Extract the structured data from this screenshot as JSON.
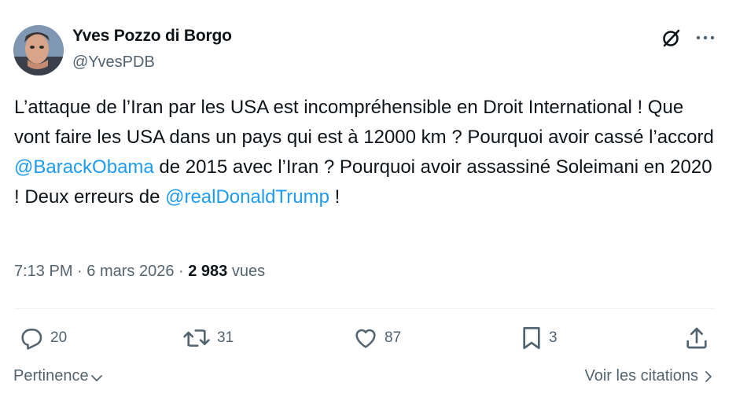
{
  "author": {
    "name": "Yves Pozzo di Borgo",
    "handle": "@YvesPDB"
  },
  "tweet": {
    "text_parts": {
      "p1": "L’attaque de l’Iran par les USA est incompréhensible en Droit International ! Que vont faire les USA dans un pays qui est à 12000 km ? Pourquoi avoir cassé l’accord ",
      "mention1": "@BarackObama",
      "p2": " de 2015 avec l’Iran ? Pourquoi avoir assassiné Soleimani en 2020 ! Deux erreurs de ",
      "mention2": "@realDonaldTrump",
      "p3": " !"
    },
    "time": "7:13 PM",
    "separator": " · ",
    "date": "6 mars 2026",
    "views_count": "2 983",
    "views_label": " vues"
  },
  "actions": {
    "replies": "20",
    "retweets": "31",
    "likes": "87",
    "bookmarks": "3"
  },
  "footer": {
    "sort_label": "Pertinence",
    "quotes_label": "Voir les citations"
  },
  "colors": {
    "accent": "#1d9bf0",
    "text": "#0f1419",
    "secondary": "#536471"
  },
  "icons": [
    "grok-icon",
    "more-icon",
    "reply-icon",
    "retweet-icon",
    "like-icon",
    "bookmark-icon",
    "share-icon",
    "chevron-down-icon",
    "chevron-right-icon"
  ]
}
